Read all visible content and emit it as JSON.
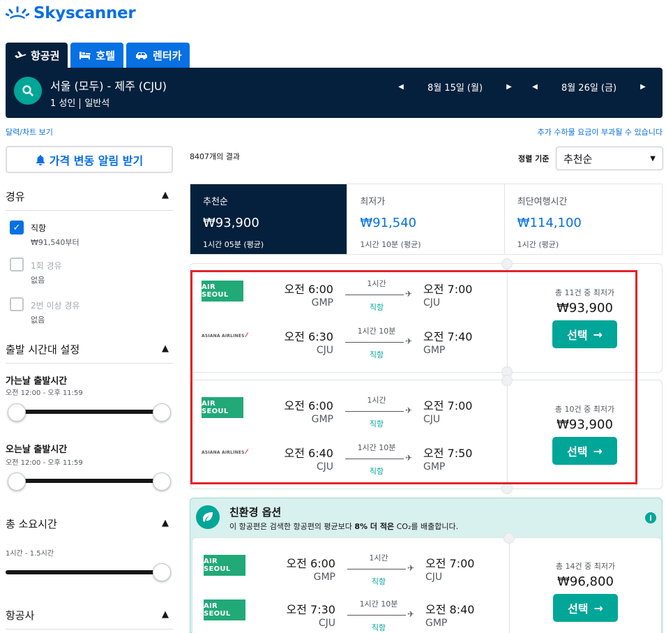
{
  "brand": {
    "name": "Skyscanner",
    "color": "#0770e3"
  },
  "tabs": [
    {
      "label": "항공권",
      "icon": "plane-icon",
      "active": true
    },
    {
      "label": "호텔",
      "icon": "bed-icon",
      "active": false
    },
    {
      "label": "렌터카",
      "icon": "car-icon",
      "active": false
    }
  ],
  "search": {
    "route": "서울 (모두) - 제주 (CJU)",
    "passengers": "1 성인",
    "cabin": "일반석",
    "depart_date": "8월 15일 (월)",
    "return_date": "8월 26일 (금)"
  },
  "links": {
    "calendar": "달력/차트 보기",
    "fees": "추가 수하물 요금이 부과될 수 있습니다"
  },
  "sidebar": {
    "alert_button": "가격 변동 알림 받기",
    "stops": {
      "title": "경유",
      "options": [
        {
          "label": "직항",
          "sub": "₩91,540부터",
          "checked": true
        },
        {
          "label": "1회 경유",
          "sub": "없음",
          "checked": false
        },
        {
          "label": "2번 이상 경유",
          "sub": "없음",
          "checked": false
        }
      ]
    },
    "times": {
      "title": "출발 시간대 설정",
      "outbound_label": "가는날 출발시간",
      "outbound_range": "오전 12:00 - 오후 11:59",
      "return_label": "오는날 출발시간",
      "return_range": "오전 12:00 - 오후 11:59"
    },
    "duration": {
      "title": "총 소요시간",
      "range": "1시간 - 1.5시간"
    },
    "airlines": {
      "title": "항공사"
    }
  },
  "results": {
    "count": "8407개의 결과",
    "sort_label": "정렬 기준",
    "sort_value": "추천순"
  },
  "sort_tabs": [
    {
      "title": "추천순",
      "price": "₩93,900",
      "duration": "1시간 05분 (평균)",
      "active": true
    },
    {
      "title": "최저가",
      "price": "₩91,540",
      "duration": "1시간 10분 (평균)",
      "active": false
    },
    {
      "title": "최단여행시간",
      "price": "₩114,100",
      "duration": "1시간 (평균)",
      "active": false
    }
  ],
  "cards": [
    {
      "deals": "총 11건 중 최저가",
      "price": "₩93,900",
      "select": "선택",
      "legs": [
        {
          "airline": "AIR SEOUL",
          "dep_time": "오전 6:00",
          "dep_code": "GMP",
          "duration": "1시간",
          "stops": "직항",
          "arr_time": "오전 7:00",
          "arr_code": "CJU"
        },
        {
          "airline": "ASIANA AIRLINES",
          "dep_time": "오전 6:30",
          "dep_code": "CJU",
          "duration": "1시간 10분",
          "stops": "직항",
          "arr_time": "오전 7:40",
          "arr_code": "GMP"
        }
      ]
    },
    {
      "deals": "총 10건 중 최저가",
      "price": "₩93,900",
      "select": "선택",
      "legs": [
        {
          "airline": "AIR SEOUL",
          "dep_time": "오전 6:00",
          "dep_code": "GMP",
          "duration": "1시간",
          "stops": "직항",
          "arr_time": "오전 7:00",
          "arr_code": "CJU"
        },
        {
          "airline": "ASIANA AIRLINES",
          "dep_time": "오전 6:40",
          "dep_code": "CJU",
          "duration": "1시간 10분",
          "stops": "직항",
          "arr_time": "오전 7:50",
          "arr_code": "GMP"
        }
      ]
    },
    {
      "deals": "총 14건 중 최저가",
      "price": "₩96,800",
      "select": "선택",
      "legs": [
        {
          "airline": "AIR SEOUL",
          "dep_time": "오전 6:00",
          "dep_code": "GMP",
          "duration": "1시간",
          "stops": "직항",
          "arr_time": "오전 7:00",
          "arr_code": "CJU"
        },
        {
          "airline": "AIR SEOUL",
          "dep_time": "오전 7:30",
          "dep_code": "CJU",
          "duration": "1시간 10분",
          "stops": "직항",
          "arr_time": "오전 8:40",
          "arr_code": "GMP"
        }
      ]
    }
  ],
  "eco": {
    "title": "친환경 옵션",
    "text_before": "이 항공편은 검색한 항공편의 평균보다 ",
    "text_bold": "8% 더 적은",
    "text_co2": "CO₂",
    "text_after": "를 배출합니다."
  },
  "colors": {
    "navy": "#05203c",
    "teal": "#00a698",
    "blue": "#0770e3",
    "highlight_frame": "#e2232a",
    "airseoul_green": "#21a978"
  }
}
